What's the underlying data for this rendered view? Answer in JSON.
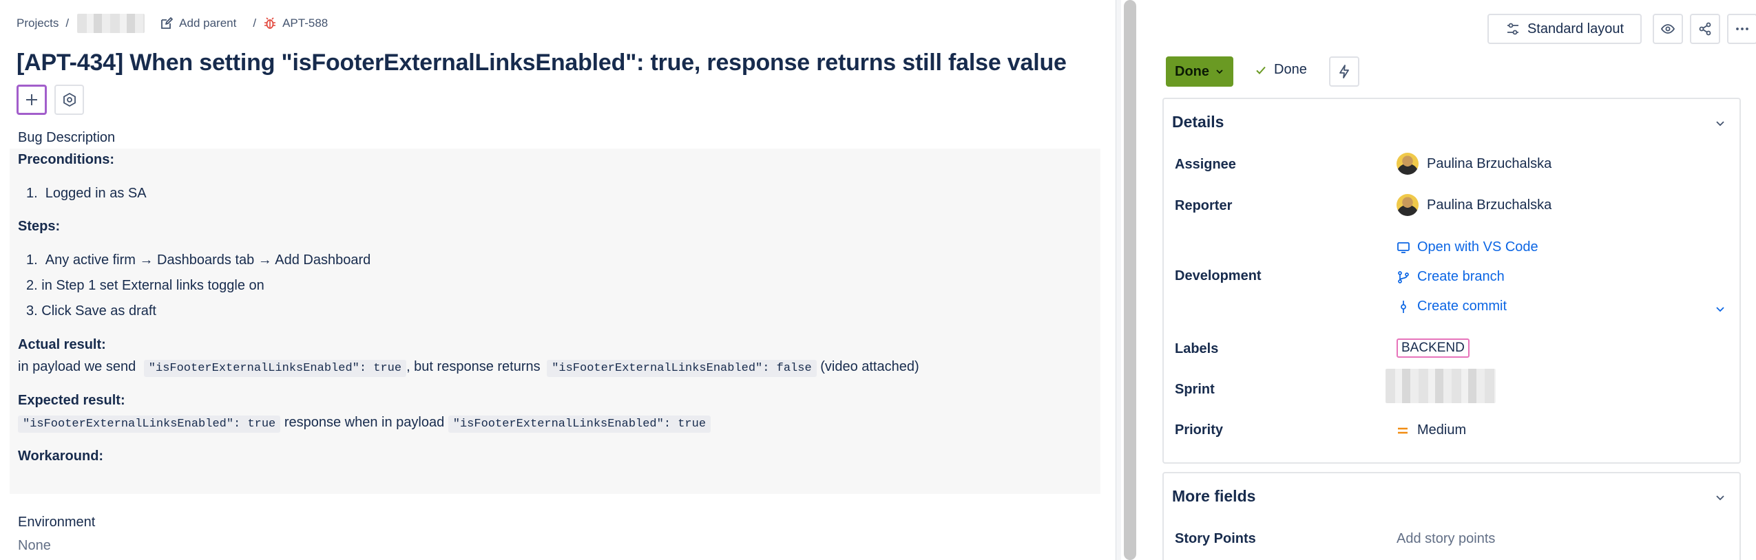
{
  "breadcrumbs": {
    "projects": "Projects",
    "add_parent": "Add parent",
    "issue_key": "APT-588"
  },
  "issue": {
    "title": "[APT-434] When setting \"isFooterExternalLinksEnabled\": true, response returns still false value"
  },
  "description": {
    "heading": "Bug Description",
    "preconditions_label": "Preconditions:",
    "preconditions": [
      "Logged in as SA"
    ],
    "steps_label": "Steps:",
    "steps": [
      "Any active firm → Dashboards tab → Add Dashboard",
      "in Step 1 set External links toggle on",
      "Click Save as draft"
    ],
    "actual_label": "Actual result:",
    "actual_pre": "in payload we send",
    "actual_code1": "\"isFooterExternalLinksEnabled\": true",
    "actual_mid": ", but response returns",
    "actual_code2": "\"isFooterExternalLinksEnabled\": false",
    "actual_post": "(video attached)",
    "expected_label": "Expected result:",
    "expected_code1": "\"isFooterExternalLinksEnabled\": true",
    "expected_mid": "response when in payload",
    "expected_code2": "\"isFooterExternalLinksEnabled\": true",
    "workaround_label": "Workaround:"
  },
  "environment": {
    "heading": "Environment",
    "value": "None"
  },
  "header_actions": {
    "layout_label": "Standard layout"
  },
  "status": {
    "button_label": "Done",
    "resolution": "Done"
  },
  "details": {
    "heading": "Details",
    "assignee_label": "Assignee",
    "assignee": "Paulina Brzuchalska",
    "reporter_label": "Reporter",
    "reporter": "Paulina Brzuchalska",
    "development_label": "Development",
    "dev_links": [
      "Open with VS Code",
      "Create branch",
      "Create commit"
    ],
    "labels_label": "Labels",
    "label_tag": "BACKEND",
    "sprint_label": "Sprint",
    "priority_label": "Priority",
    "priority": "Medium"
  },
  "more_fields": {
    "heading": "More fields",
    "story_points_label": "Story Points",
    "story_points_placeholder": "Add story points"
  },
  "colors": {
    "status_green": "#6a9a23",
    "link_blue": "#0c66e4",
    "label_pink": "#e774bb",
    "priority_orange": "#f18d13",
    "focus_purple": "#a25ecb",
    "bug_red": "#e2483d"
  }
}
